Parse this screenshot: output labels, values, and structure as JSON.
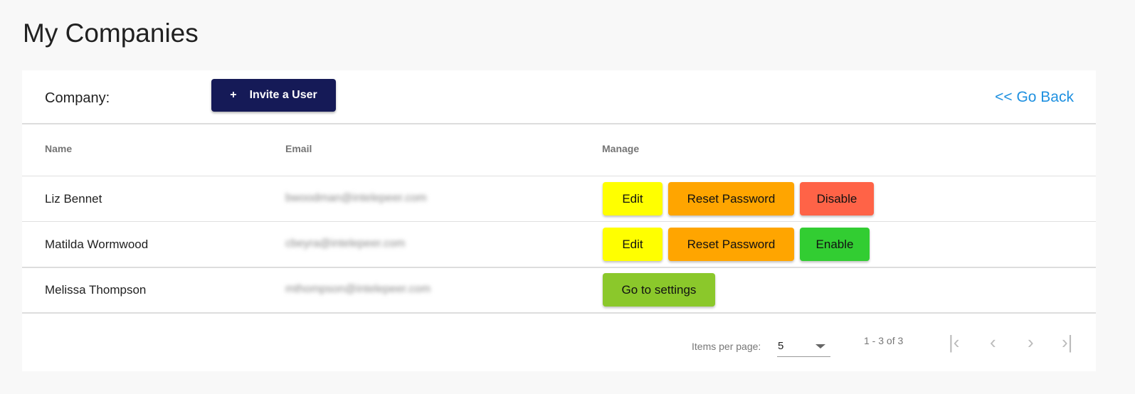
{
  "page_title": "My Companies",
  "toolbar": {
    "company_label": "Company:",
    "invite_icon": "+",
    "invite_label": "Invite a User",
    "go_back": "<< Go Back"
  },
  "columns": [
    "Name",
    "Email",
    "Manage"
  ],
  "rows": [
    {
      "name": "Liz Bennet",
      "email": "bwoodman@intelepeer.com",
      "actions": [
        "Edit",
        "Reset Password",
        "Disable"
      ]
    },
    {
      "name": "Matilda Wormwood",
      "email": "cbeyra@intelepeer.com",
      "actions": [
        "Edit",
        "Reset Password",
        "Enable"
      ]
    },
    {
      "name": "Melissa Thompson",
      "email": "mthompson@intelepeer.com",
      "actions": [
        "Go to settings"
      ]
    }
  ],
  "colors": {
    "edit": "#ffff00",
    "reset": "#ffa500",
    "disable": "#ff6347",
    "enable": "#32cd32",
    "settings": "#8bc82b",
    "invite": "#151a57",
    "link": "#1e90e0"
  },
  "paginator": {
    "items_per_page_label": "Items per page:",
    "items_per_page": "5",
    "range": "1 - 3 of 3",
    "first_icon": "first-page",
    "prev_icon": "chevron-left",
    "next_icon": "chevron-right",
    "last_icon": "last-page"
  }
}
